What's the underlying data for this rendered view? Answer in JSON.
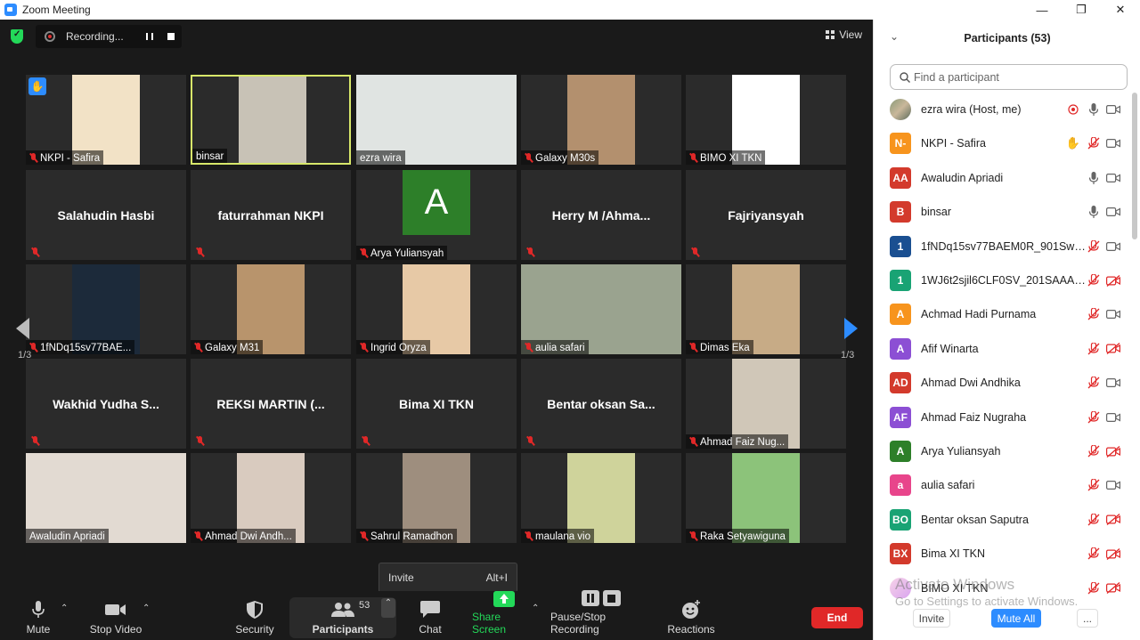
{
  "window": {
    "title": "Zoom Meeting",
    "min": "—",
    "max": "❐",
    "close": "✕"
  },
  "recording": {
    "label": "Recording..."
  },
  "view": {
    "label": "View"
  },
  "gallery": {
    "tiles": [
      {
        "name": "NKPI - Safira",
        "muted": true,
        "hand": true,
        "kind": "video",
        "bg": "#f2e2c6"
      },
      {
        "name": "binsar",
        "muted": false,
        "kind": "video",
        "active": true,
        "bg": "#c8c2b6"
      },
      {
        "name": "ezra wira",
        "muted": false,
        "kind": "video",
        "bg": "#e0e4e2"
      },
      {
        "name": "Galaxy M30s",
        "muted": true,
        "kind": "video",
        "bg": "#b3906e"
      },
      {
        "name": "BIMO XI TKN",
        "muted": true,
        "kind": "video",
        "bg": "#ffffff"
      },
      {
        "name": "Salahudin Hasbi",
        "muted": true,
        "kind": "name"
      },
      {
        "name": "faturrahman NKPI",
        "muted": true,
        "kind": "name"
      },
      {
        "name": "Arya Yuliansyah",
        "muted": true,
        "kind": "avatar",
        "avatar": "A"
      },
      {
        "name": "Herry M /Ahma...",
        "muted": true,
        "kind": "name"
      },
      {
        "name": "Fajriyansyah",
        "muted": true,
        "kind": "name"
      },
      {
        "name": "1fNDq15sv77BAE...",
        "muted": true,
        "kind": "video",
        "bg": "#1c2a3a"
      },
      {
        "name": "Galaxy M31",
        "muted": true,
        "kind": "video",
        "bg": "#b8946c"
      },
      {
        "name": "Ingrid Oryza",
        "muted": true,
        "kind": "video",
        "bg": "#e7c9a6"
      },
      {
        "name": "aulia safari",
        "muted": true,
        "kind": "video",
        "bg": "#9aa38f"
      },
      {
        "name": "Dimas Eka",
        "muted": true,
        "kind": "video",
        "bg": "#c7ab86"
      },
      {
        "name": "Wakhid Yudha S...",
        "muted": true,
        "kind": "name"
      },
      {
        "name": "REKSI MARTIN (...",
        "muted": true,
        "kind": "name"
      },
      {
        "name": "Bima XI TKN",
        "muted": true,
        "kind": "name"
      },
      {
        "name": "Bentar oksan Sa...",
        "muted": true,
        "kind": "name"
      },
      {
        "name": "Ahmad Faiz Nug...",
        "muted": true,
        "kind": "video",
        "bg": "#d0c7b8"
      },
      {
        "name": "Awaludin Apriadi",
        "muted": false,
        "kind": "video",
        "bg": "#e2dad2"
      },
      {
        "name": "Ahmad Dwi Andh...",
        "muted": true,
        "kind": "video",
        "bg": "#d9cbbf"
      },
      {
        "name": "Sahrul Ramadhon",
        "muted": true,
        "kind": "video",
        "bg": "#9e8e7e"
      },
      {
        "name": "maulana vio",
        "muted": true,
        "kind": "video",
        "bg": "#cfd39b"
      },
      {
        "name": "Raka Setyawiguna",
        "muted": true,
        "kind": "video",
        "bg": "#8cc37a"
      }
    ],
    "page_left": "1/3",
    "page_right": "1/3"
  },
  "toolbar": {
    "mute": "Mute",
    "stop_video": "Stop Video",
    "security": "Security",
    "participants": "Participants",
    "participants_count": "53",
    "chat": "Chat",
    "share_screen": "Share Screen",
    "recording": "Pause/Stop Recording",
    "reactions": "Reactions",
    "end": "End"
  },
  "invite_popup": {
    "label": "Invite",
    "shortcut": "Alt+I"
  },
  "panel": {
    "title": "Participants (53)",
    "search_placeholder": "Find a participant",
    "participants": [
      {
        "initials": "",
        "color": "#888888",
        "name": "ezra wira (Host, me)",
        "photo": true,
        "rec": true,
        "mic": "on",
        "video": "on"
      },
      {
        "initials": "N-",
        "color": "#f7941d",
        "name": "NKPI - Safira",
        "hand": true,
        "mic": "off",
        "video": "on"
      },
      {
        "initials": "AA",
        "color": "#d33a2c",
        "name": "Awaludin Apriadi",
        "mic": "on",
        "video": "on"
      },
      {
        "initials": "B",
        "color": "#d33a2c",
        "name": "binsar",
        "mic": "on",
        "video": "on"
      },
      {
        "initials": "1",
        "color": "#1a4f91",
        "name": "1fNDq15sv77BAEM0R_901SwKg...",
        "mic": "off",
        "video": "on"
      },
      {
        "initials": "1",
        "color": "#19a374",
        "name": "1WJ6t2sjil6CLF0SV_201SAAAAAB...",
        "mic": "off",
        "video": "off"
      },
      {
        "initials": "A",
        "color": "#f7941d",
        "name": "Achmad Hadi Purnama",
        "mic": "off",
        "video": "on"
      },
      {
        "initials": "A",
        "color": "#8c4fd4",
        "name": "Afif Winarta",
        "mic": "off",
        "video": "off"
      },
      {
        "initials": "AD",
        "color": "#d33a2c",
        "name": "Ahmad Dwi Andhika",
        "mic": "off",
        "video": "on"
      },
      {
        "initials": "AF",
        "color": "#8c4fd4",
        "name": "Ahmad Faiz Nugraha",
        "mic": "off",
        "video": "on"
      },
      {
        "initials": "A",
        "color": "#2d7f29",
        "name": "Arya Yuliansyah",
        "mic": "off",
        "video": "off"
      },
      {
        "initials": "a",
        "color": "#e8458b",
        "name": "aulia safari",
        "mic": "off",
        "video": "on"
      },
      {
        "initials": "BO",
        "color": "#19a374",
        "name": "Bentar oksan Saputra",
        "mic": "off",
        "video": "off"
      },
      {
        "initials": "BX",
        "color": "#d33a2c",
        "name": "Bima XI TKN",
        "mic": "off",
        "video": "off"
      },
      {
        "initials": "",
        "color": "#ffffff",
        "name": "BIMO XI TKN",
        "photo": true,
        "mic": "off",
        "video": "off"
      }
    ],
    "invite": "Invite",
    "mute_all": "Mute All",
    "more": "..."
  },
  "watermark": {
    "line1": "Activate Windows",
    "line2": "Go to Settings to activate Windows."
  },
  "colors": {
    "accent": "#2d8cff",
    "muted_red": "#e02828",
    "end_red": "#e02828",
    "active_border": "#d8e86a",
    "share_green": "#23d959"
  }
}
